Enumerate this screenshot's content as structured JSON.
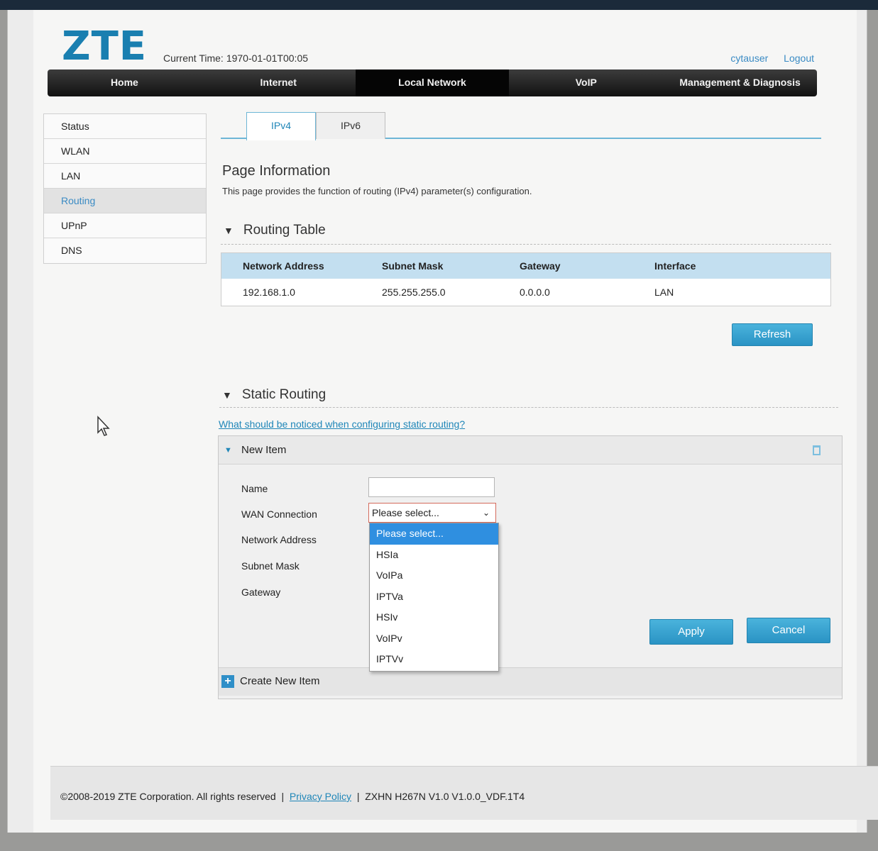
{
  "header": {
    "logo": "ZTE",
    "current_time_label": "Current Time:",
    "current_time_value": "1970-01-01T00:05",
    "user": "cytauser",
    "logout": "Logout"
  },
  "nav": [
    "Home",
    "Internet",
    "Local Network",
    "VoIP",
    "Management & Diagnosis"
  ],
  "nav_active": "Local Network",
  "sidebar": {
    "items": [
      "Status",
      "WLAN",
      "LAN",
      "Routing",
      "UPnP",
      "DNS"
    ],
    "active": "Routing"
  },
  "tabs": [
    "IPv4",
    "IPv6"
  ],
  "main": {
    "title": "Page Information",
    "description": "This page provides the function of routing (IPv4) parameter(s) configuration.",
    "routing_table": {
      "title": "Routing Table",
      "columns": [
        "Network Address",
        "Subnet Mask",
        "Gateway",
        "Interface"
      ],
      "rows": [
        [
          "192.168.1.0",
          "255.255.255.0",
          "0.0.0.0",
          "LAN"
        ]
      ],
      "refresh_button": "Refresh"
    },
    "static_routing": {
      "title": "Static Routing",
      "help_link": "What should be noticed when configuring static routing?",
      "new_item_title": "New Item",
      "fields": {
        "name": "Name",
        "wan_connection": "WAN Connection",
        "network_address": "Network Address",
        "subnet_mask": "Subnet Mask",
        "gateway": "Gateway"
      },
      "wan_select_value": "Please select...",
      "wan_options": [
        "Please select...",
        "HSIa",
        "VoIPa",
        "IPTVa",
        "HSIv",
        "VoIPv",
        "IPTVv"
      ],
      "apply_button": "Apply",
      "cancel_button": "Cancel",
      "create_new_item": "Create New Item"
    }
  },
  "footer": {
    "copyright": "©2008-2019 ZTE Corporation. All rights reserved",
    "separator": "|",
    "privacy_policy": "Privacy Policy",
    "version": "ZXHN H267N V1.0 V1.0.0_VDF.1T4"
  },
  "colors": {
    "brand_blue": "#1a7fb0",
    "button_blue": "#2a93c4",
    "table_header": "#c3dff0",
    "dropdown_highlight": "#2f8fe0"
  }
}
